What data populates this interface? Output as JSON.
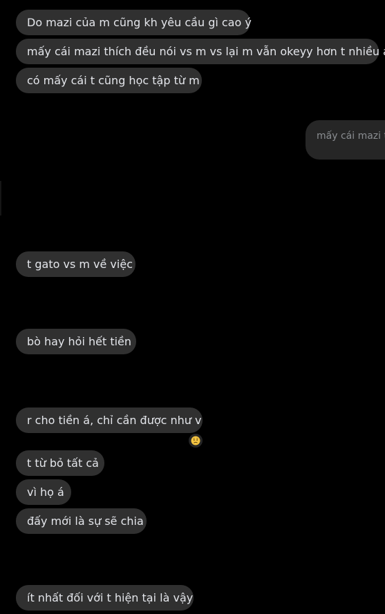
{
  "conversation": {
    "messages": [
      {
        "text": "Do mazi của m cũng kh yêu cầu gì cao ý"
      },
      {
        "text": "mấy cái mazi thích đều nói vs m vs lại m vẫn okeyy hơn t nhiều á"
      },
      {
        "text": "có mấy cái t cũng học tập từ m"
      },
      {
        "text": "mấy cái mazi th"
      },
      {
        "text": "t gato vs m về việc"
      },
      {
        "text": "bò hay hỏi hết tiền"
      },
      {
        "text": "r cho tiền á, chỉ cần được như v"
      },
      {
        "text": "t từ bỏ tất cả"
      },
      {
        "text": "vì họ á"
      },
      {
        "text": "đấy mới là sự sẽ chia"
      },
      {
        "text": "ít nhất đối với t hiện tại là vậy"
      }
    ],
    "reaction": {
      "icon": "worried-face-emoji"
    }
  },
  "colors": {
    "background": "#000000",
    "bubble_received": "#303030",
    "bubble_sent_faded": "#262626",
    "text": "#e4e6eb",
    "text_faded": "#8a8d91"
  }
}
